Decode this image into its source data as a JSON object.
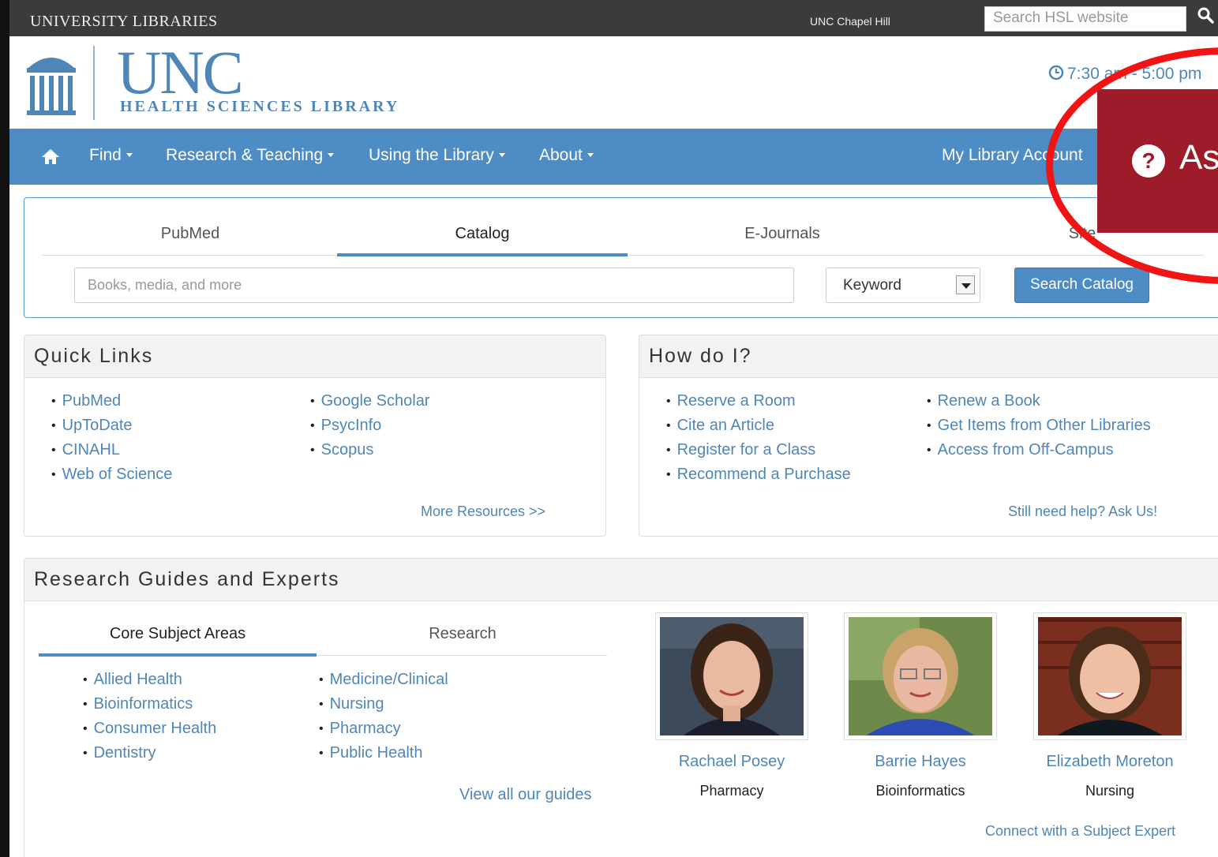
{
  "topbar": {
    "brand": "UNIVERSITY LIBRARIES",
    "campus_link": "UNC Chapel Hill",
    "search_placeholder": "Search HSL website"
  },
  "header": {
    "logo_word": "UNC",
    "logo_subtitle": "HEALTH SCIENCES LIBRARY",
    "hours": "7:30 am - 5:00 pm"
  },
  "nav": {
    "items": [
      "Find",
      "Research & Teaching",
      "Using the Library",
      "About"
    ],
    "account": "My Library Account",
    "ask": "Ask"
  },
  "search": {
    "tabs": [
      "PubMed",
      "Catalog",
      "E-Journals",
      "Site"
    ],
    "active_tab": "Catalog",
    "placeholder": "Books, media, and more",
    "select_value": "Keyword",
    "button": "Search Catalog"
  },
  "quick_links": {
    "title": "Quick Links",
    "col1": [
      "PubMed",
      "UpToDate",
      "CINAHL",
      "Web of Science"
    ],
    "col2": [
      "Google Scholar",
      "PsycInfo",
      "Scopus"
    ],
    "more": "More Resources >>"
  },
  "how_do_i": {
    "title": "How do I?",
    "col1": [
      "Reserve a Room",
      "Cite an Article",
      "Register for a Class",
      "Recommend a Purchase"
    ],
    "col2": [
      "Renew a Book",
      "Get Items from Other Libraries",
      "Access from Off-Campus"
    ],
    "more": "Still need help? Ask Us!"
  },
  "guides": {
    "title": "Research Guides and Experts",
    "tabs": [
      "Core Subject Areas",
      "Research"
    ],
    "col1": [
      "Allied Health",
      "Bioinformatics",
      "Consumer Health",
      "Dentistry"
    ],
    "col2": [
      "Medicine/Clinical",
      "Nursing",
      "Pharmacy",
      "Public Health"
    ],
    "view_all": "View all our guides",
    "experts": [
      {
        "name": "Rachael Posey",
        "area": "Pharmacy"
      },
      {
        "name": "Barrie Hayes",
        "area": "Bioinformatics"
      },
      {
        "name": "Elizabeth Moreton",
        "area": "Nursing"
      }
    ],
    "connect": "Connect with a Subject Expert"
  },
  "colors": {
    "brand_blue": "#4d8cc4",
    "ask_red": "#9e1b2a",
    "highlight": "#f01414"
  }
}
